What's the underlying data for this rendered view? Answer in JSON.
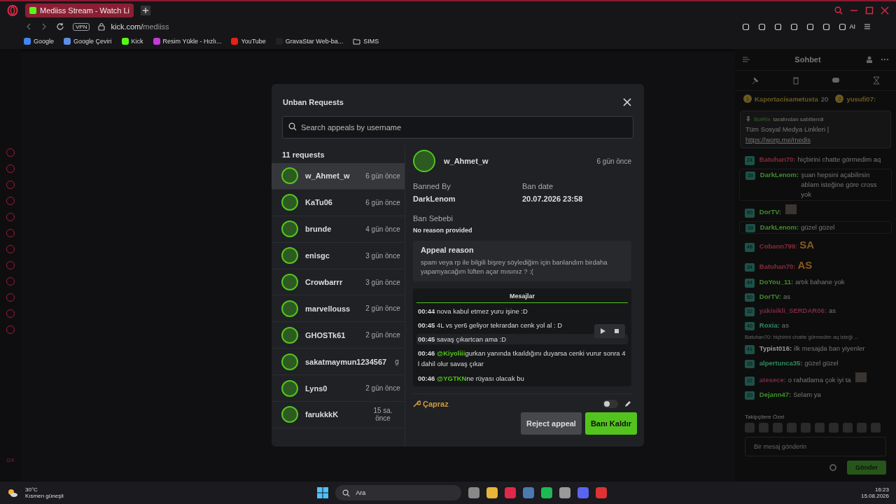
{
  "browser": {
    "tab_title": "Mediiss Stream - Watch Li",
    "vpn": "VPN",
    "url_host": "kick.com/",
    "url_path": "mediiss",
    "ai": "AI",
    "bookmarks": [
      {
        "label": "Google",
        "kind": "google"
      },
      {
        "label": "Google Çeviri",
        "kind": "translate"
      },
      {
        "label": "Kick",
        "kind": "kick"
      },
      {
        "label": "Resim Yükle - Hızlı...",
        "kind": "image"
      },
      {
        "label": "YouTube",
        "kind": "youtube"
      },
      {
        "label": "GravaStar Web-ba...",
        "kind": "dot"
      },
      {
        "label": "SIMS",
        "kind": "folder"
      }
    ],
    "sidebar_label": "GX"
  },
  "chat": {
    "title": "Sohbet",
    "leaders": [
      {
        "rank": "1",
        "name": "Kaportacisametusta",
        "count": "20"
      },
      {
        "rank": "2",
        "name": "yusufi07:"
      }
    ],
    "pinned": {
      "author": "BotRix",
      "note": "tarafından sabitlendi",
      "text": "Tüm Sosyal Medya Linkleri |",
      "link": "https://worp.me/medis"
    },
    "messages": [
      {
        "badge": "24",
        "name": "Batuhan70:",
        "color": "#8a2b36",
        "text": "hiçbirini chatte görmedim aq",
        "kind": "text",
        "highlight": false
      },
      {
        "badge": "39",
        "name": "DarkLenom:",
        "color": "#3f8f2a",
        "text": "şuan hepsini açabilirsin ablam isteğine göre cross yok",
        "kind": "text",
        "highlight": true
      },
      {
        "badge": "50",
        "name": "DorTV:",
        "color": "#3f8f2a",
        "kind": "emote",
        "highlight": false
      },
      {
        "badge": "39",
        "name": "DarkLenom:",
        "color": "#3f8f2a",
        "text": "güzel güzel",
        "kind": "text",
        "highlight": true
      },
      {
        "badge": "48",
        "name": "Cobann799:",
        "color": "#8a2b36",
        "text": "SA",
        "kind": "big",
        "highlight": false
      },
      {
        "badge": "34",
        "name": "Batuhan70:",
        "color": "#8a2b36",
        "text": "AS",
        "kind": "big",
        "highlight": false
      },
      {
        "badge": "44",
        "name": "DoYou_11:",
        "color": "#3f8f2a",
        "text": "artık bahane yok",
        "kind": "text",
        "highlight": false
      },
      {
        "badge": "50",
        "name": "DorTV:",
        "color": "#3f8f2a",
        "text": "as",
        "kind": "text",
        "highlight": false
      },
      {
        "badge": "32",
        "name": "yakisikli_SERDAR06:",
        "color": "#7a2845",
        "text": "as",
        "kind": "text",
        "highlight": false
      },
      {
        "badge": "40",
        "name": "Roxia:",
        "color": "#2f8a62",
        "text": "as",
        "kind": "text",
        "highlight": false
      },
      {
        "badge": "41",
        "name": "Typist016:",
        "color": "#9a9a9a",
        "text": "ilk mesajda ban yiyenler",
        "kind": "text",
        "highlight": false,
        "reply": "Batuhan70: hiçbirini chatte görmedim aq isteği ..."
      },
      {
        "badge": "25",
        "name": "alpertunca35:",
        "color": "#2f8a62",
        "text": "güzel güzel",
        "kind": "text",
        "highlight": false
      },
      {
        "badge": "22",
        "name": "atesece:",
        "color": "#7a2845",
        "text": "o rahatlama çok iyi ta",
        "kind": "emote",
        "highlight": false
      },
      {
        "badge": "20",
        "name": "Dejann47:",
        "color": "#3f8f2a",
        "text": "Selam ya",
        "kind": "text",
        "highlight": false
      }
    ],
    "emotes_label": "Takipçilere Özel",
    "placeholder": "Bir mesaj gönderin",
    "send": "Gönder"
  },
  "modal": {
    "title": "Unban Requests",
    "search_placeholder": "Search appeals by username",
    "count": "11 requests",
    "requests": [
      {
        "name": "w_Ahmet_w",
        "time": "6 gün önce",
        "selected": true
      },
      {
        "name": "KaTu06",
        "time": "6 gün önce",
        "selected": false
      },
      {
        "name": "brunde",
        "time": "4 gün önce",
        "selected": false
      },
      {
        "name": "enisgc",
        "time": "3 gün önce",
        "selected": false
      },
      {
        "name": "Crowbarrr",
        "time": "3 gün önce",
        "selected": false
      },
      {
        "name": "marvellouss",
        "time": "2 gün önce",
        "selected": false
      },
      {
        "name": "GHOSTk61",
        "time": "2 gün önce",
        "selected": false
      },
      {
        "name": "sakatmaymun1234567",
        "time": "g",
        "selected": false
      },
      {
        "name": "Lyns0",
        "time": "2 gün önce",
        "selected": false
      },
      {
        "name": "farukkkK",
        "time": "15 sa. önce",
        "selected": false
      }
    ],
    "detail": {
      "name": "w_Ahmet_w",
      "time": "6 gün önce",
      "banned_by_label": "Banned By",
      "banned_by": "DarkLenom",
      "ban_date_label": "Ban date",
      "ban_date": "20.07.2026 23:58",
      "reason_label": "Ban Sebebi",
      "reason": "No reason provided",
      "appeal_label": "Appeal reason",
      "appeal": "spam veya rp ile bilgili bişrey söylediğim için banlandım birdaha yapamyacağım lüften açar mısınız ? :(",
      "messages_tab": "Mesajlar",
      "messages": [
        {
          "time": "00:44",
          "text": "nova kabul etmez yuru işine :D",
          "hovered": false
        },
        {
          "time": "00:45",
          "text": "4L vs yer6 geliyor tekrardan cenk yol al : D",
          "hovered": false
        },
        {
          "time": "00:45",
          "text": "savaş çıkartcan ama :D",
          "hovered": true
        },
        {
          "time": "00:46",
          "mention": "@Kiyoliii",
          "text": "gurkan yanında tkaıldığını duyarsa cenki vurur sonra 4 l dahil olur savaş çıkar",
          "hovered": false
        },
        {
          "time": "00:46",
          "mention": "@YGTKN",
          "text": "ne rüyası olacak bu",
          "hovered": false
        }
      ],
      "moderator": "Çapraz",
      "toggle_on": false,
      "reject": "Reject appeal",
      "unban": "Banı Kaldır"
    }
  },
  "taskbar": {
    "temp": "30°C",
    "weather": "Kısmen güneşli",
    "search": "Ara",
    "time": "16:23",
    "date": "15.08.2026"
  }
}
